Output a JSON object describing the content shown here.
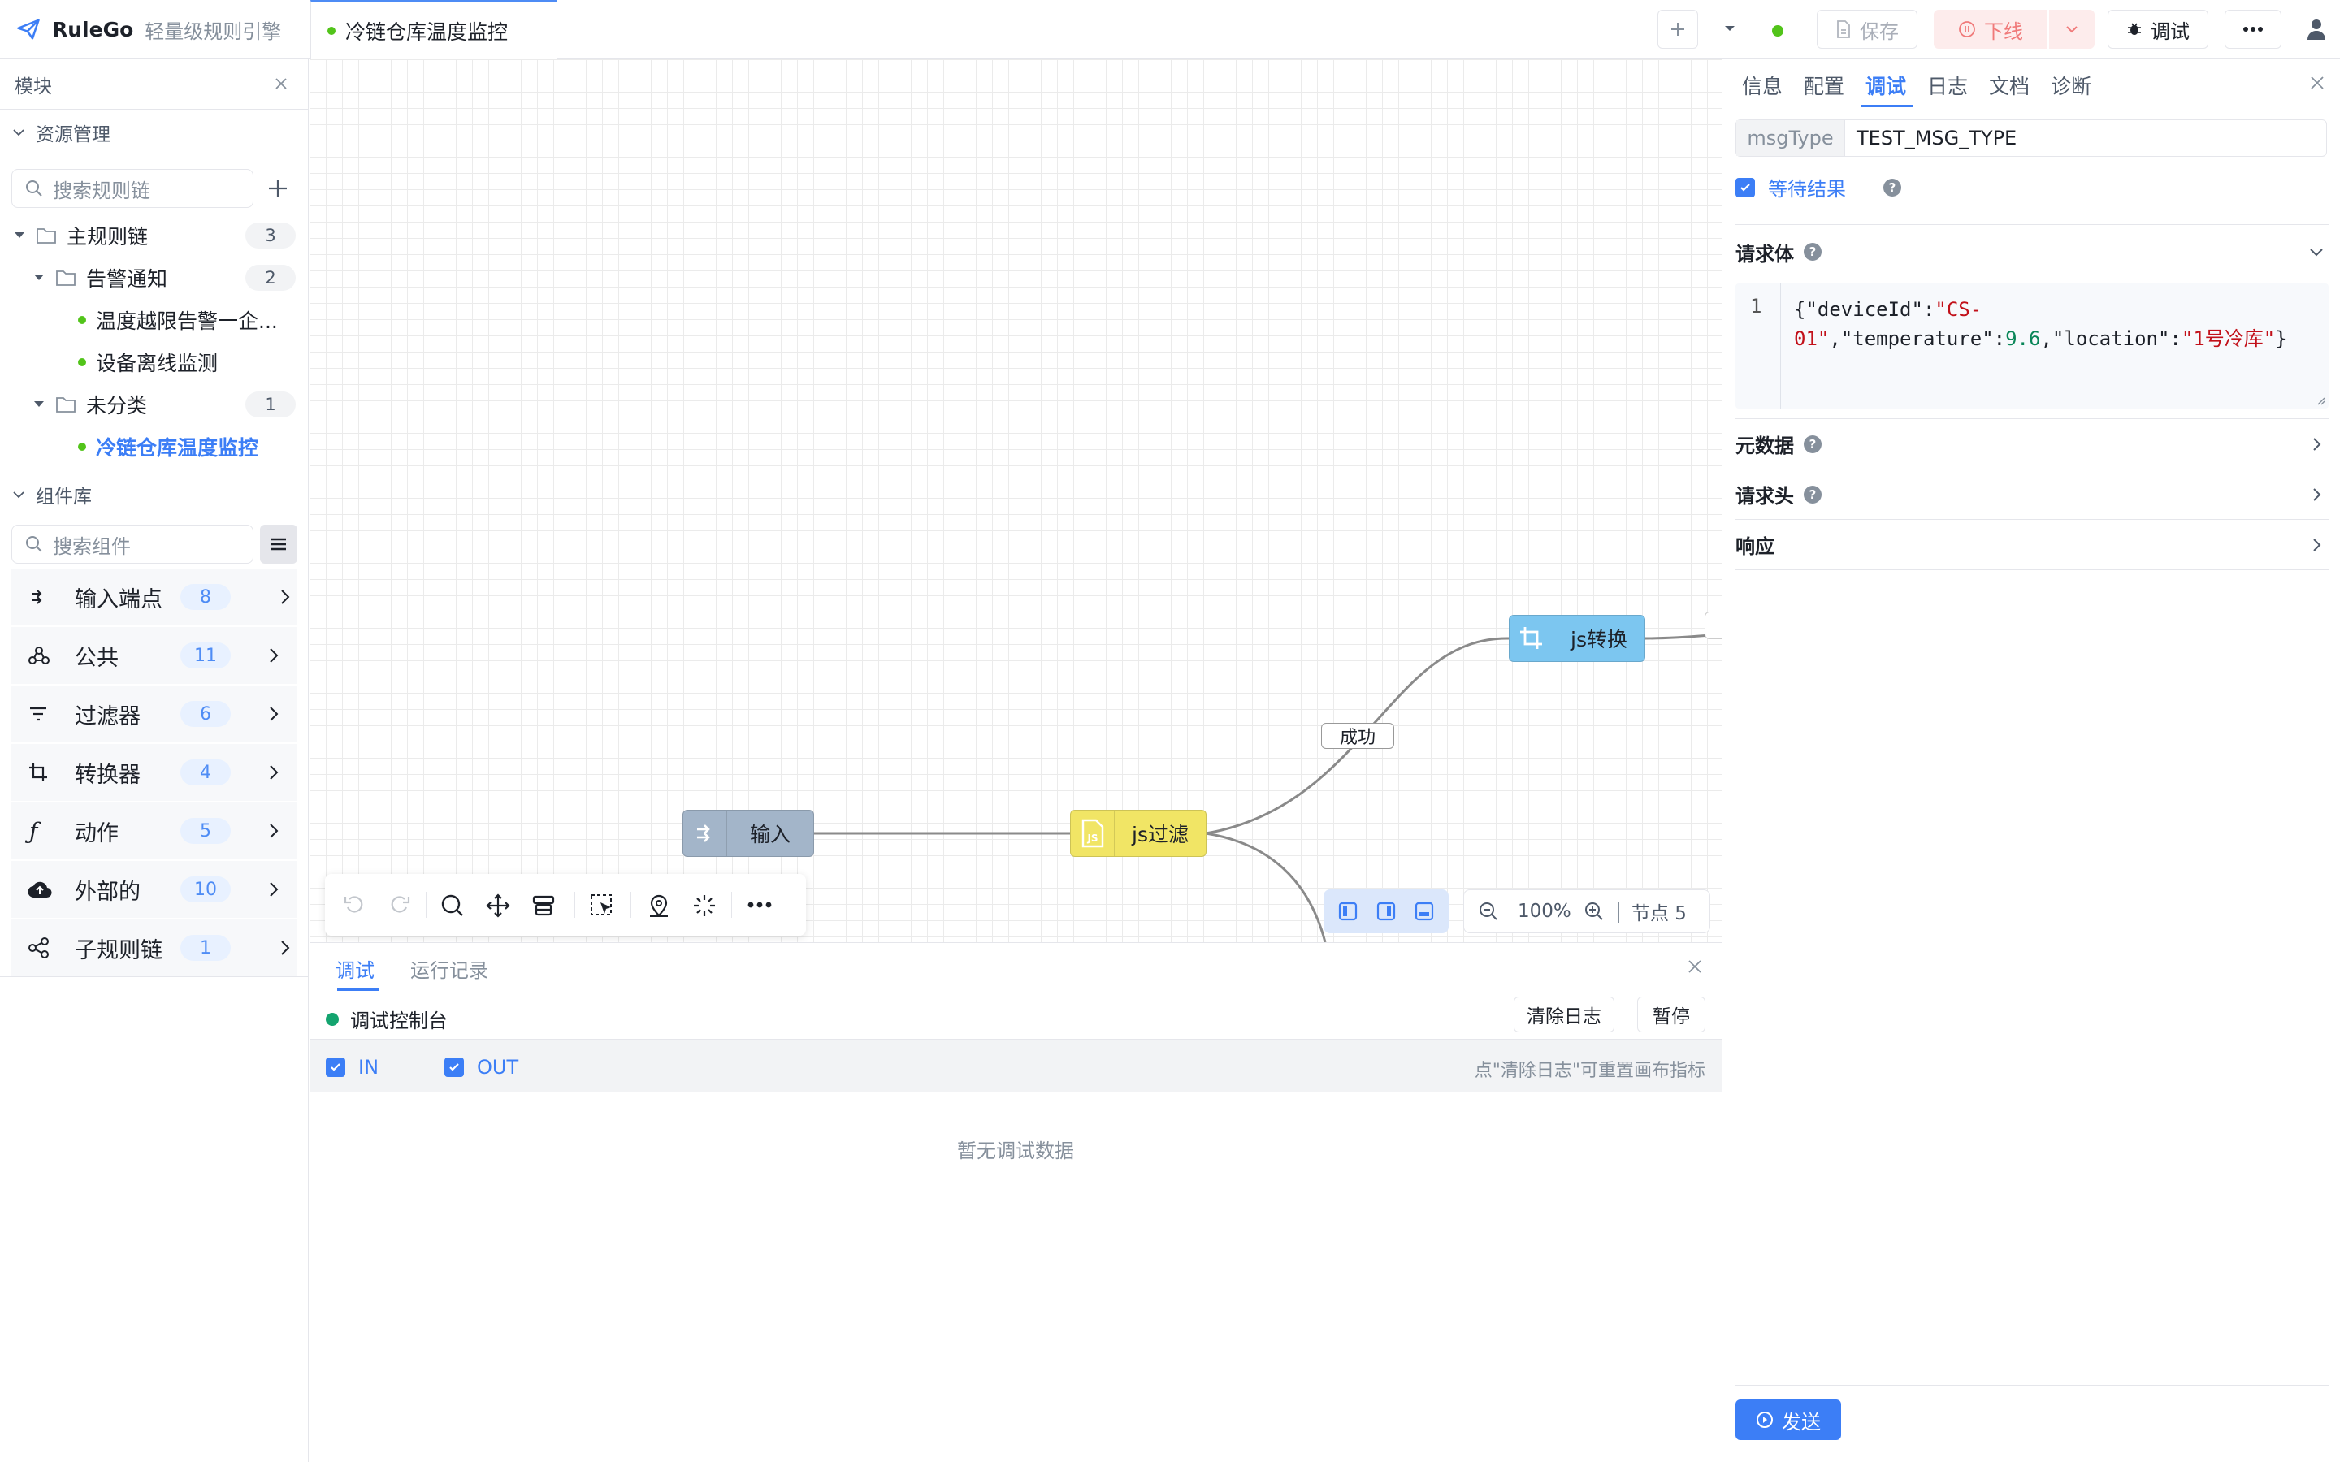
{
  "header": {
    "app_name": "RuleGo",
    "app_subtitle": "轻量级规则引擎",
    "active_tab": "冷链仓库温度监控",
    "save_label": "保存",
    "offline_label": "下线",
    "debug_label": "调试",
    "status_color": "#52c41a"
  },
  "sidebar": {
    "panel_title": "模块",
    "resources_title": "资源管理",
    "search_chain_placeholder": "搜索规则链",
    "tree": [
      {
        "label": "主规则链",
        "count": "3"
      },
      {
        "label": "告警通知",
        "count": "2"
      },
      {
        "label": "温度越限告警一企..."
      },
      {
        "label": "设备离线监测"
      },
      {
        "label": "未分类",
        "count": "1"
      },
      {
        "label": "冷链仓库温度监控"
      }
    ],
    "components_title": "组件库",
    "search_component_placeholder": "搜索组件",
    "components": [
      {
        "label": "输入端点",
        "count": "8",
        "icon": "input-endpoint-icon"
      },
      {
        "label": "公共",
        "count": "11",
        "icon": "common-icon"
      },
      {
        "label": "过滤器",
        "count": "6",
        "icon": "filter-icon"
      },
      {
        "label": "转换器",
        "count": "4",
        "icon": "transform-icon"
      },
      {
        "label": "动作",
        "count": "5",
        "icon": "function-icon"
      },
      {
        "label": "外部的",
        "count": "10",
        "icon": "cloud-upload-icon"
      },
      {
        "label": "子规则链",
        "count": "1",
        "icon": "share-icon"
      }
    ]
  },
  "canvas": {
    "nodes": [
      {
        "label": "输入",
        "color": "#a3b5c9"
      },
      {
        "label": "js过滤",
        "color": "#f1e565"
      },
      {
        "label": "js转换",
        "color": "#7cc6f0"
      }
    ],
    "edge_label": "成功",
    "zoom": "100%",
    "node_count": "节点 5"
  },
  "debug": {
    "tabs": [
      "调试",
      "运行记录"
    ],
    "console_title": "调试控制台",
    "clear_label": "清除日志",
    "pause_label": "暂停",
    "filter_in": "IN",
    "filter_out": "OUT",
    "hint": "点\"清除日志\"可重置画布指标",
    "empty": "暂无调试数据"
  },
  "right": {
    "tabs": [
      "信息",
      "配置",
      "调试",
      "日志",
      "文档",
      "诊断"
    ],
    "msgtype_label": "msgType",
    "msgtype_value": "TEST_MSG_TYPE",
    "wait_label": "等待结果",
    "body_title": "请求体",
    "line_no": "1",
    "code": {
      "l1_open": "{",
      "k_device": "\"deviceId\"",
      "colon1": ":",
      "v_device_a": "\"CS-",
      "v_device_b": "01\"",
      "comma1": ",",
      "k_temp": "\"temperature\"",
      "colon2": ":",
      "v_temp": "9.6",
      "comma2": ",",
      "k_loc": "\"location\"",
      "colon3": ":",
      "v_loc": "\"1号冷库\"",
      "close": "}"
    },
    "metadata_title": "元数据",
    "headers_title": "请求头",
    "response_title": "响应",
    "send_label": "发送"
  }
}
